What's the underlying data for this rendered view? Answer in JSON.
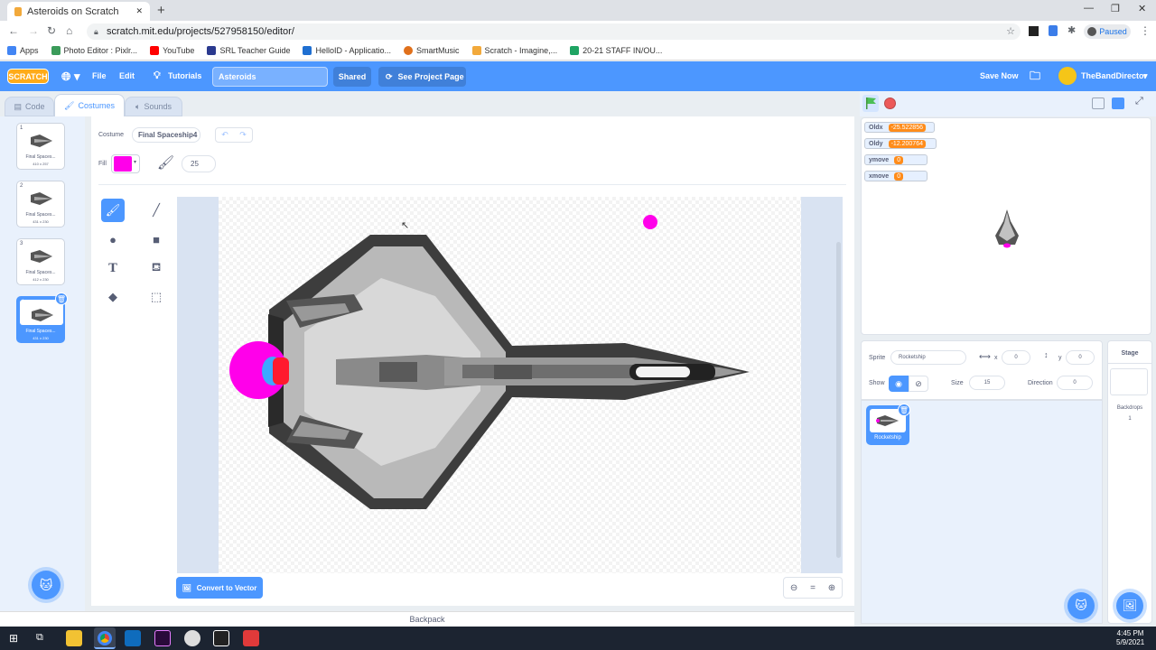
{
  "browser": {
    "tab_title": "Asteroids on Scratch",
    "new_tab": "+",
    "close_tab": "✕",
    "url": "scratch.mit.edu/projects/527958150/editor/",
    "profile_status": "Paused",
    "window_min": "—",
    "window_max": "❐",
    "window_close": "✕",
    "bookmarks": [
      {
        "label": "Apps",
        "color": "#4285f4"
      },
      {
        "label": "Photo Editor : Pixlr...",
        "color": "#3b9b5a"
      },
      {
        "label": "YouTube",
        "color": "#ff0000"
      },
      {
        "label": "SRL Teacher Guide",
        "color": "#2b3a8f"
      },
      {
        "label": "HelloID - Applicatio...",
        "color": "#1f6fd1"
      },
      {
        "label": "SmartMusic",
        "color": "#e0701b"
      },
      {
        "label": "Scratch - Imagine,...",
        "color": "#f2a93b"
      },
      {
        "label": "20-21 STAFF IN/OU...",
        "color": "#1fa463"
      }
    ]
  },
  "menubar": {
    "logo": "SCRATCH",
    "file": "File",
    "edit": "Edit",
    "tutorials": "Tutorials",
    "project_title": "Asteroids",
    "shared": "Shared",
    "see_project_page": "See Project Page",
    "save_now": "Save Now",
    "username": "TheBandDirector"
  },
  "tabs": {
    "code": "Code",
    "costumes": "Costumes",
    "sounds": "Sounds"
  },
  "costumes": [
    {
      "num": "1",
      "name": "Final Spaces...",
      "size": "410 x 257"
    },
    {
      "num": "2",
      "name": "Final Spaces...",
      "size": "431 x 230"
    },
    {
      "num": "3",
      "name": "Final Spaces...",
      "size": "412 x 230"
    },
    {
      "num": "4",
      "name": "Final Spaces...",
      "size": "431 x 230"
    }
  ],
  "paint": {
    "costume_label": "Costume",
    "costume_name": "Final Spaceship4",
    "fill_label": "Fill",
    "fill_color": "#ff00ea",
    "brush_size": "25",
    "convert": "Convert to Vector",
    "zoom_equals": "="
  },
  "backpack": "Backpack",
  "monitors": [
    {
      "name": "Oldx",
      "value": "-25.522856"
    },
    {
      "name": "Oldy",
      "value": "-12.200764"
    },
    {
      "name": "ymove",
      "value": "0"
    },
    {
      "name": "xmove",
      "value": "0"
    }
  ],
  "sprite_info": {
    "sprite_label": "Sprite",
    "sprite_name": "Rocketship",
    "x_label": "x",
    "x": "0",
    "y_label": "y",
    "y": "0",
    "show_label": "Show",
    "size_label": "Size",
    "size": "15",
    "direction_label": "Direction",
    "direction": "0"
  },
  "sprite_card": "Rocketship",
  "stage_panel": {
    "title": "Stage",
    "backdrops_label": "Backdrops",
    "backdrops_count": "1"
  },
  "taskbar": {
    "time": "4:45 PM",
    "date": "5/9/2021"
  }
}
